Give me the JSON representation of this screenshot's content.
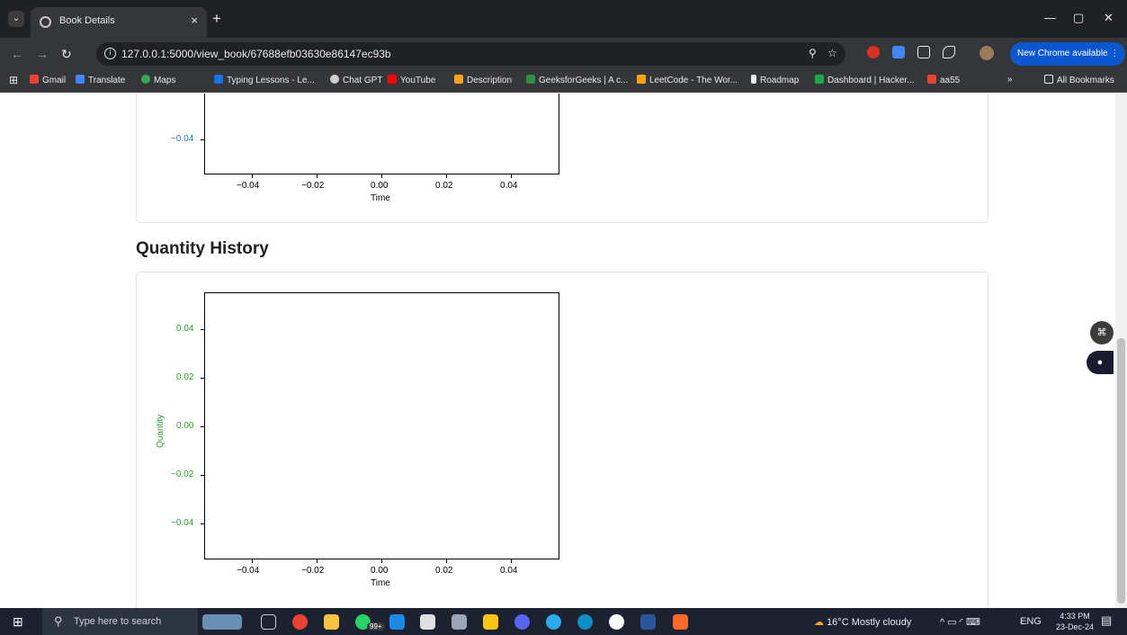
{
  "browser": {
    "tab_title": "Book Details",
    "url": "127.0.0.1:5000/view_book/67688efb03630e86147ec93b",
    "update_label": "New Chrome available",
    "bookmarks": [
      "Gmail",
      "Translate",
      "Maps",
      "Typing Lessons - Le...",
      "Chat GPT",
      "YouTube",
      "Description",
      "GeeksforGeeks | A c...",
      "LeetCode - The Wor...",
      "Roadmap",
      "Dashboard | Hacker...",
      "aa55"
    ],
    "all_bookmarks": "All Bookmarks"
  },
  "page": {
    "section_title": "Quantity History"
  },
  "chart_data": [
    {
      "type": "line",
      "title": "",
      "xlabel": "Time",
      "ylabel": "",
      "x_ticks": [
        "−0.04",
        "−0.02",
        "0.00",
        "0.02",
        "0.04"
      ],
      "y_ticks": [
        "−0.04"
      ],
      "series": [],
      "ytick_color": "#1f77b4",
      "grid": false
    },
    {
      "type": "line",
      "title": "Quantity History",
      "xlabel": "Time",
      "ylabel": "Quantity",
      "x_ticks": [
        "−0.04",
        "−0.02",
        "0.00",
        "0.02",
        "0.04"
      ],
      "y_ticks": [
        "0.04",
        "0.02",
        "0.00",
        "−0.02",
        "−0.04"
      ],
      "series": [],
      "ytick_color": "#2ca02c",
      "grid": false
    }
  ],
  "taskbar": {
    "search_placeholder": "Type here to search",
    "whatsapp_badge": "99+",
    "weather": "16°C  Mostly cloudy",
    "language": "ENG",
    "time": "4:33 PM",
    "date": "23-Dec-24"
  }
}
